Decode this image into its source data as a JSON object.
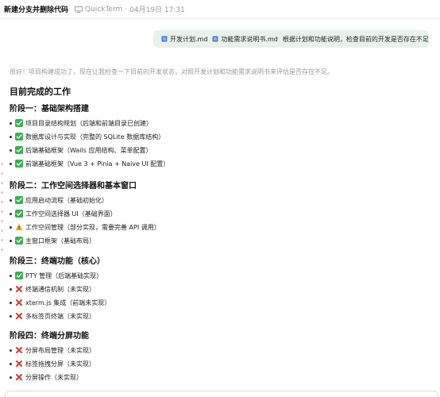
{
  "header": {
    "title": "新建分支并删除代码",
    "app": "QuickTerm",
    "separator": "·",
    "date": "04月19日 17:31",
    "monitor_icon": "monitor-icon"
  },
  "user_message": {
    "attachments": [
      {
        "name": "开发计划.md",
        "icon": "file-icon"
      },
      {
        "name": "功能需求说明书.md",
        "icon": "file-icon"
      }
    ],
    "text": "根据计划和功能说明，检查目前的开发是否存在不足"
  },
  "response": {
    "intro": "很好！项目构建成功了。现在让我检查一下目前的开发状态，对照开发计划和功能需求说明书来评估是否存在不足。",
    "heading": "目前完成的工作",
    "sections": [
      {
        "title": "阶段一：基础架构搭建",
        "items": [
          {
            "status": "done",
            "text": "项目目录结构规划（后端和前端目录已创建）"
          },
          {
            "status": "done",
            "text": "数据库设计与实现（完整的 SQLite 数据库结构）"
          },
          {
            "status": "done",
            "text": "后端基础框架（Wails 应用结构、菜单配置）"
          },
          {
            "status": "done",
            "text": "前端基础框架（Vue 3 + Pinia + Naive UI 配置）"
          }
        ]
      },
      {
        "title": "阶段二：工作空间选择器和基本窗口",
        "items": [
          {
            "status": "done",
            "text": "应用启动流程（基础初始化）"
          },
          {
            "status": "done",
            "text": "工作空间选择器 UI（基础界面）"
          },
          {
            "status": "warn",
            "text": "工作空间管理（部分实现，需要完善 API 调用）"
          },
          {
            "status": "done",
            "text": "主窗口框架（基础布局）"
          }
        ]
      },
      {
        "title": "阶段三：终端功能（核心）",
        "items": [
          {
            "status": "done",
            "text": "PTY 管理（后端基础实现）"
          },
          {
            "status": "missing",
            "text": "终端通信机制（未实现）"
          },
          {
            "status": "missing",
            "text": "xterm.js 集成（前端未实现）"
          },
          {
            "status": "missing",
            "text": "多标签页终端（未实现）"
          }
        ]
      },
      {
        "title": "阶段四：终端分屏功能",
        "items": [
          {
            "status": "missing",
            "text": "分屏布局管理（未实现）"
          },
          {
            "status": "missing",
            "text": "标签拖拽分屏（未实现）"
          },
          {
            "status": "missing",
            "text": "分屏操作（未实现）"
          }
        ]
      }
    ]
  },
  "colors": {
    "done": "#35b34a",
    "missing": "#d93a2b",
    "warn": "#f2b01e",
    "bubble": "#e9f2ea"
  }
}
